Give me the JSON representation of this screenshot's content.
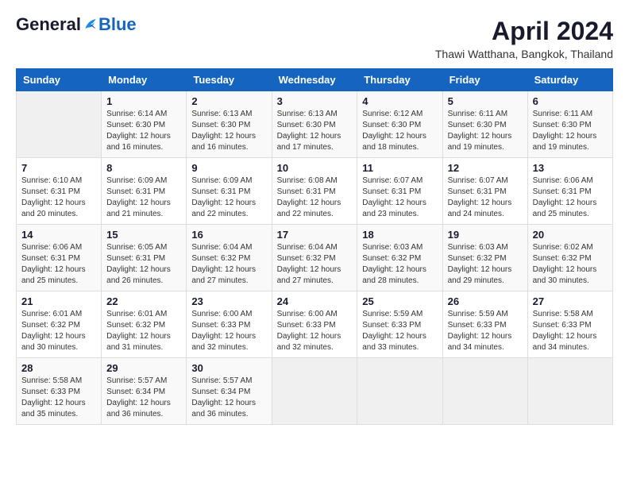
{
  "header": {
    "logo_general": "General",
    "logo_blue": "Blue",
    "month_title": "April 2024",
    "location": "Thawi Watthana, Bangkok, Thailand"
  },
  "calendar": {
    "headers": [
      "Sunday",
      "Monday",
      "Tuesday",
      "Wednesday",
      "Thursday",
      "Friday",
      "Saturday"
    ],
    "weeks": [
      [
        {
          "day": "",
          "info": ""
        },
        {
          "day": "1",
          "info": "Sunrise: 6:14 AM\nSunset: 6:30 PM\nDaylight: 12 hours\nand 16 minutes."
        },
        {
          "day": "2",
          "info": "Sunrise: 6:13 AM\nSunset: 6:30 PM\nDaylight: 12 hours\nand 16 minutes."
        },
        {
          "day": "3",
          "info": "Sunrise: 6:13 AM\nSunset: 6:30 PM\nDaylight: 12 hours\nand 17 minutes."
        },
        {
          "day": "4",
          "info": "Sunrise: 6:12 AM\nSunset: 6:30 PM\nDaylight: 12 hours\nand 18 minutes."
        },
        {
          "day": "5",
          "info": "Sunrise: 6:11 AM\nSunset: 6:30 PM\nDaylight: 12 hours\nand 19 minutes."
        },
        {
          "day": "6",
          "info": "Sunrise: 6:11 AM\nSunset: 6:30 PM\nDaylight: 12 hours\nand 19 minutes."
        }
      ],
      [
        {
          "day": "7",
          "info": "Sunrise: 6:10 AM\nSunset: 6:31 PM\nDaylight: 12 hours\nand 20 minutes."
        },
        {
          "day": "8",
          "info": "Sunrise: 6:09 AM\nSunset: 6:31 PM\nDaylight: 12 hours\nand 21 minutes."
        },
        {
          "day": "9",
          "info": "Sunrise: 6:09 AM\nSunset: 6:31 PM\nDaylight: 12 hours\nand 22 minutes."
        },
        {
          "day": "10",
          "info": "Sunrise: 6:08 AM\nSunset: 6:31 PM\nDaylight: 12 hours\nand 22 minutes."
        },
        {
          "day": "11",
          "info": "Sunrise: 6:07 AM\nSunset: 6:31 PM\nDaylight: 12 hours\nand 23 minutes."
        },
        {
          "day": "12",
          "info": "Sunrise: 6:07 AM\nSunset: 6:31 PM\nDaylight: 12 hours\nand 24 minutes."
        },
        {
          "day": "13",
          "info": "Sunrise: 6:06 AM\nSunset: 6:31 PM\nDaylight: 12 hours\nand 25 minutes."
        }
      ],
      [
        {
          "day": "14",
          "info": "Sunrise: 6:06 AM\nSunset: 6:31 PM\nDaylight: 12 hours\nand 25 minutes."
        },
        {
          "day": "15",
          "info": "Sunrise: 6:05 AM\nSunset: 6:31 PM\nDaylight: 12 hours\nand 26 minutes."
        },
        {
          "day": "16",
          "info": "Sunrise: 6:04 AM\nSunset: 6:32 PM\nDaylight: 12 hours\nand 27 minutes."
        },
        {
          "day": "17",
          "info": "Sunrise: 6:04 AM\nSunset: 6:32 PM\nDaylight: 12 hours\nand 27 minutes."
        },
        {
          "day": "18",
          "info": "Sunrise: 6:03 AM\nSunset: 6:32 PM\nDaylight: 12 hours\nand 28 minutes."
        },
        {
          "day": "19",
          "info": "Sunrise: 6:03 AM\nSunset: 6:32 PM\nDaylight: 12 hours\nand 29 minutes."
        },
        {
          "day": "20",
          "info": "Sunrise: 6:02 AM\nSunset: 6:32 PM\nDaylight: 12 hours\nand 30 minutes."
        }
      ],
      [
        {
          "day": "21",
          "info": "Sunrise: 6:01 AM\nSunset: 6:32 PM\nDaylight: 12 hours\nand 30 minutes."
        },
        {
          "day": "22",
          "info": "Sunrise: 6:01 AM\nSunset: 6:32 PM\nDaylight: 12 hours\nand 31 minutes."
        },
        {
          "day": "23",
          "info": "Sunrise: 6:00 AM\nSunset: 6:33 PM\nDaylight: 12 hours\nand 32 minutes."
        },
        {
          "day": "24",
          "info": "Sunrise: 6:00 AM\nSunset: 6:33 PM\nDaylight: 12 hours\nand 32 minutes."
        },
        {
          "day": "25",
          "info": "Sunrise: 5:59 AM\nSunset: 6:33 PM\nDaylight: 12 hours\nand 33 minutes."
        },
        {
          "day": "26",
          "info": "Sunrise: 5:59 AM\nSunset: 6:33 PM\nDaylight: 12 hours\nand 34 minutes."
        },
        {
          "day": "27",
          "info": "Sunrise: 5:58 AM\nSunset: 6:33 PM\nDaylight: 12 hours\nand 34 minutes."
        }
      ],
      [
        {
          "day": "28",
          "info": "Sunrise: 5:58 AM\nSunset: 6:33 PM\nDaylight: 12 hours\nand 35 minutes."
        },
        {
          "day": "29",
          "info": "Sunrise: 5:57 AM\nSunset: 6:34 PM\nDaylight: 12 hours\nand 36 minutes."
        },
        {
          "day": "30",
          "info": "Sunrise: 5:57 AM\nSunset: 6:34 PM\nDaylight: 12 hours\nand 36 minutes."
        },
        {
          "day": "",
          "info": ""
        },
        {
          "day": "",
          "info": ""
        },
        {
          "day": "",
          "info": ""
        },
        {
          "day": "",
          "info": ""
        }
      ]
    ]
  }
}
